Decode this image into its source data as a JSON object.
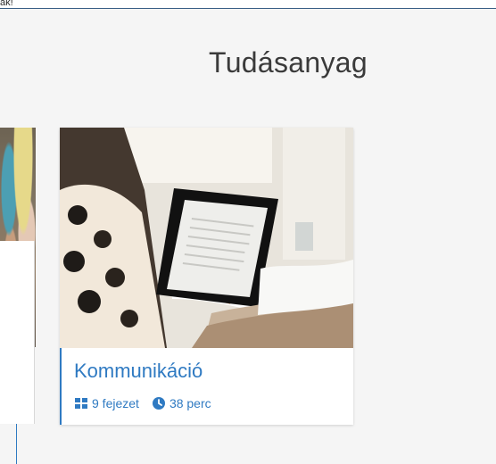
{
  "topbar": {
    "text": "ak!"
  },
  "section": {
    "title": "Tudásanyag"
  },
  "card": {
    "title": "Kommunikáció",
    "chapters": "9 fejezet",
    "duration": "38 perc",
    "accent_color": "#2f7ac2"
  },
  "icons": {
    "chapters": "grid-icon",
    "duration": "clock-icon"
  }
}
